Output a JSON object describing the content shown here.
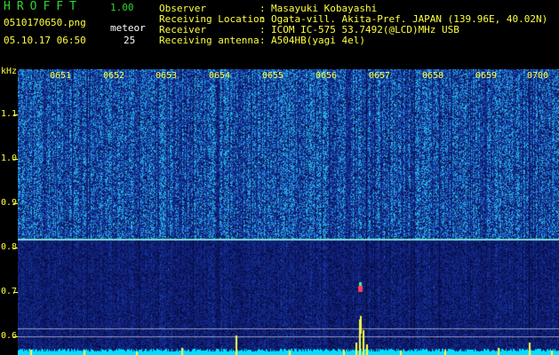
{
  "app": {
    "title": "HROFFT",
    "version": "1.00"
  },
  "file": {
    "name": "0510170650.png",
    "timestamp": "05.10.17 06:50"
  },
  "meteor": {
    "label": "meteor",
    "count": "25"
  },
  "info": {
    "observer_label": "Observer",
    "observer": "Masayuki Kobayashi",
    "location_label": "Receiving Location",
    "location": "Ogata-vill. Akita-Pref. JAPAN (139.96E, 40.02N)",
    "receiver_label": "Receiver",
    "receiver": "ICOM IC-575 53.7492(@LCD)MHz USB",
    "antenna_label": "Receiving antenna",
    "antenna": "A504HB(yagi 4el)",
    "separator": ":"
  },
  "axis": {
    "unit": "kHz",
    "freq_labels": [
      "1.1",
      "1.0",
      "0.9",
      "0.8",
      "0.7",
      "0.6"
    ],
    "time_labels": [
      "0651",
      "0652",
      "0653",
      "0654",
      "0655",
      "0656",
      "0657",
      "0658",
      "0659",
      "0700"
    ]
  },
  "colors": {
    "label_yellow": "#ffff40",
    "title_green": "#2fd62f",
    "background_blue": "#14288c",
    "trace_cyan": "#00e0ff"
  }
}
